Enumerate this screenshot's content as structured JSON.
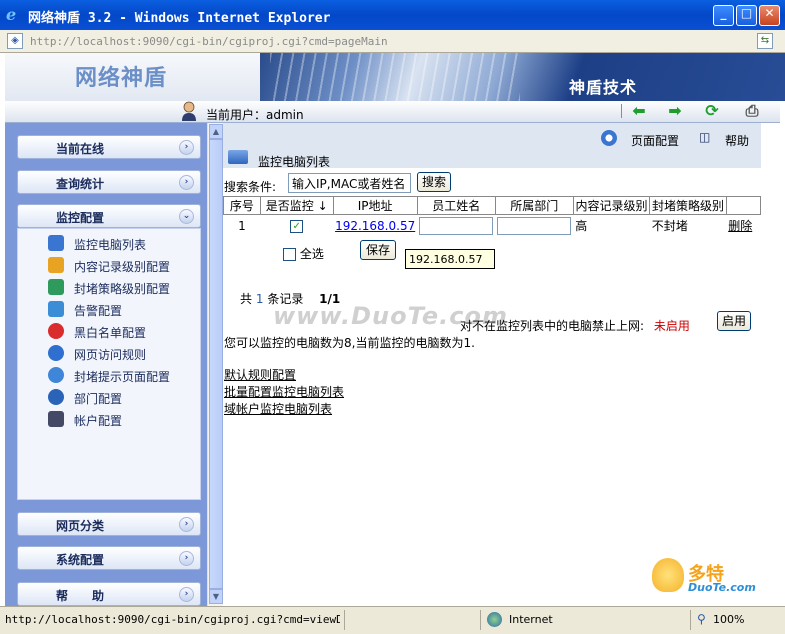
{
  "window": {
    "title": "网络神盾 3.2 - Windows Internet Explorer",
    "minimize": "_",
    "maximize": "□",
    "close": "✕"
  },
  "address": {
    "url": "http://localhost:9090/cgi-bin/cgiproj.cgi?cmd=pageMain"
  },
  "banner": {
    "brand": "网络神盾",
    "company": "神盾技术"
  },
  "userbar": {
    "label": "当前用户：admin",
    "tools": [
      "back-arrow-icon",
      "forward-arrow-icon",
      "refresh-icon",
      "print-icon"
    ]
  },
  "sidebar": {
    "headers": [
      {
        "label": "当前在线",
        "chevron": "›"
      },
      {
        "label": "查询统计",
        "chevron": "›"
      },
      {
        "label": "监控配置",
        "chevron": "⌄"
      },
      {
        "label": "网页分类",
        "chevron": "›"
      },
      {
        "label": "系统配置",
        "chevron": "›"
      },
      {
        "label": "帮　　助",
        "chevron": "›"
      }
    ],
    "items": [
      {
        "label": "监控电脑列表",
        "icon": "computer-list-icon",
        "color": "#3a76d1"
      },
      {
        "label": "内容记录级别配置",
        "icon": "content-level-icon",
        "color": "#e8a323"
      },
      {
        "label": "封堵策略级别配置",
        "icon": "block-policy-icon",
        "color": "#2e9a5b"
      },
      {
        "label": "告警配置",
        "icon": "alert-icon",
        "color": "#3b8ed6"
      },
      {
        "label": "黑白名单配置",
        "icon": "blacklist-icon",
        "color": "#d92c2c"
      },
      {
        "label": "网页访问规则",
        "icon": "web-rule-icon",
        "color": "#2f6fcf"
      },
      {
        "label": "封堵提示页面配置",
        "icon": "block-page-icon",
        "color": "#3f86d8"
      },
      {
        "label": "部门配置",
        "icon": "department-icon",
        "color": "#2a63b8"
      },
      {
        "label": "帐户配置",
        "icon": "account-icon",
        "color": "#444a66"
      }
    ]
  },
  "main": {
    "page_config": "页面配置",
    "help": "帮助",
    "page_title": "监控电脑列表",
    "search_label": "搜索条件:",
    "search_placeholder": "输入IP,MAC或者姓名",
    "search_button": "搜索",
    "table": {
      "headers": [
        "序号",
        "是否监控 ↓",
        "IP地址",
        "员工姓名",
        "所属部门",
        "内容记录级别",
        "封堵策略级别",
        ""
      ],
      "rows": [
        {
          "index": "1",
          "checked": "✓",
          "ip": "192.168.0.57",
          "name": "",
          "dept": "",
          "content_level": "高",
          "block_level": "不封堵",
          "action": "删除"
        }
      ]
    },
    "tooltip": "192.168.0.57",
    "select_all": "全选",
    "save": "保存",
    "summary_prefix": "共",
    "summary_count": "1",
    "summary_suffix": "条记录",
    "summary_pages": "1/1",
    "block_text": "对不在监控列表中的电脑禁止上网:",
    "block_status": "未启用",
    "enable_button": "启用",
    "watermark": "www.DuoTe.com",
    "count_text": "您可以监控的电脑数为8,当前监控的电脑数为1.",
    "links": [
      "默认规则配置",
      "批量配置监控电脑列表",
      "域帐户监控电脑列表"
    ]
  },
  "status": {
    "url": "http://localhost:9090/cgi-bin/cgiproj.cgi?cmd=viewDetail",
    "zone": "Internet",
    "zoom": "100%"
  },
  "corner_logo": {
    "name": "多特",
    "sub": "DuoTe.com"
  },
  "colors": {
    "titlebar": "#0348c8",
    "sidebar": "#7d98d8",
    "status_red": "#cc0000",
    "link_blue": "#0000ee"
  }
}
